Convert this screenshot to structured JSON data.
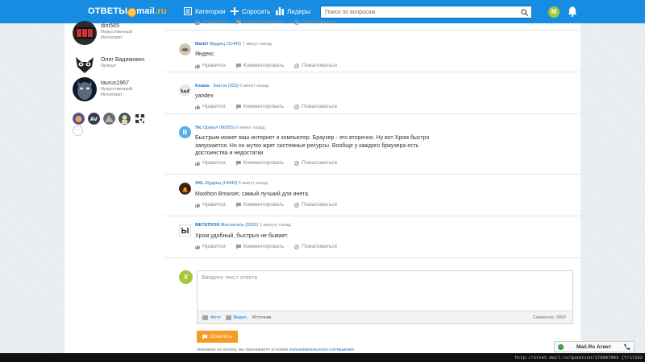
{
  "header": {
    "logo_main": "ОТВЕТЫ",
    "logo_mail": "mail",
    "logo_ru": ".ru",
    "nav": [
      {
        "label": "Категории",
        "icon": "categories-icon"
      },
      {
        "label": "Спросить",
        "icon": "plus-icon"
      },
      {
        "label": "Лидеры",
        "icon": "leaders-icon"
      }
    ],
    "search_placeholder": "Поиск по вопросам",
    "user_initial": "М"
  },
  "sidebar": {
    "leaders": [
      {
        "name": "dim565",
        "rank": "Искусственный Интеллект"
      },
      {
        "name": "Олег Вадимович",
        "rank": "Оракул"
      },
      {
        "name": "taurus1967",
        "rank": "Искусственный Интеллект"
      }
    ],
    "more_label": "···"
  },
  "answers": [
    {
      "name": "Markil",
      "rank": "Мудрец (11443)",
      "time": "7 минут назад",
      "text": "Яндекс"
    },
    {
      "name": "Кошка",
      "rank": "- Знаток (333)",
      "time": "6 минут назад",
      "text": "yandex"
    },
    {
      "name": "Vic",
      "rank": "Оракул (66055)",
      "time": "6 минут назад",
      "text": "Быстрым может ваш интернет и компьютер. Браузер - это вторично. Ну вот Хром быстро запускается. Но он жутко жрет системные ресурсы. Вообще у каждого браузера есть достоинства и недостатки.",
      "avatar_letter": "B"
    },
    {
      "name": "XXL",
      "rank": "Мудрец (14940)",
      "time": "5 минут назад",
      "text": "Maxthon Browser, самый лучший для инета."
    },
    {
      "name": "METATRON",
      "rank": "Мыслитель (5333)",
      "time": "1 минуту назад",
      "text": "Хром удобный, быстрых не бывает.",
      "avatar_letter": "Ы"
    }
  ],
  "actions": {
    "like": "Нравится",
    "comment": "Комментировать",
    "report": "Пожаловаться"
  },
  "reply": {
    "avatar_letter": "Х",
    "placeholder": "Введите текст ответа",
    "photo": "Фото",
    "video": "Видео",
    "source": "Источник:",
    "counter": "Символов: 3800",
    "submit": "Ответить",
    "terms_text": "Нажимая на кнопку, вы принимаете условия",
    "terms_link": "пользовательского соглашения"
  },
  "agent": {
    "label": "Mail.Ru Агент"
  },
  "status_url": "http://otvet.mail.ru/question/179097993 [?/17162"
}
